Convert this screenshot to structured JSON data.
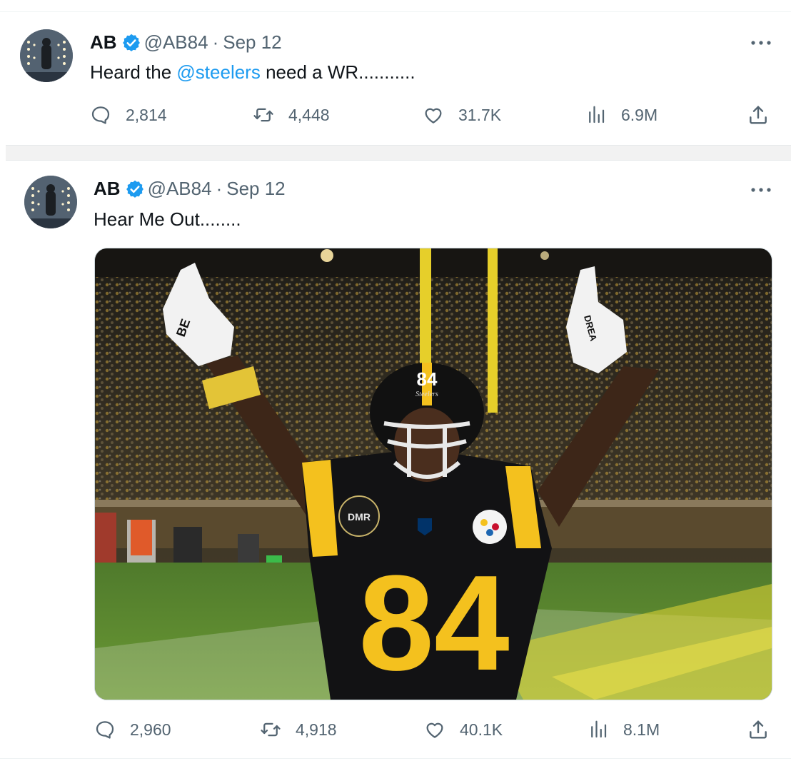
{
  "colors": {
    "accent": "#1d9bf0",
    "muted": "#536471",
    "text": "#0f1419",
    "steelers_gold": "#FFB612"
  },
  "tweets": [
    {
      "author": {
        "name": "AB",
        "handle": "@AB84",
        "verified": true,
        "avatar_icon": "avatar-photo"
      },
      "separator": "·",
      "date": "Sep 12",
      "text_before": "Heard the ",
      "mention": "@steelers",
      "text_after": " need a WR...........",
      "stats": {
        "replies": "2,814",
        "retweets": "4,448",
        "likes": "31.7K",
        "views": "6.9M"
      }
    },
    {
      "author": {
        "name": "AB",
        "handle": "@AB84",
        "verified": true,
        "avatar_icon": "avatar-photo"
      },
      "separator": "·",
      "date": "Sep 12",
      "text": "Hear Me Out........",
      "media": {
        "jersey_number": "84",
        "helmet_number": "84",
        "helmet_text": "Steelers",
        "patch_text": "DMR",
        "glove_left_text": "BE",
        "glove_right_text": "DREA"
      },
      "stats": {
        "replies": "2,960",
        "retweets": "4,918",
        "likes": "40.1K",
        "views": "8.1M"
      }
    }
  ],
  "icons": [
    "reply-icon",
    "retweet-icon",
    "like-icon",
    "views-icon",
    "share-icon",
    "more-icon",
    "verified-badge-icon"
  ]
}
